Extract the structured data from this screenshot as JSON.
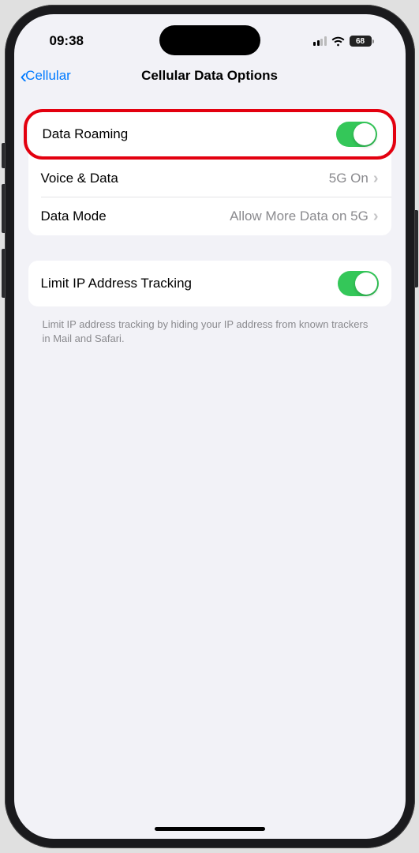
{
  "statusBar": {
    "time": "09:38",
    "batteryLevel": "68"
  },
  "navBar": {
    "backLabel": "Cellular",
    "title": "Cellular Data Options"
  },
  "group1": {
    "rows": [
      {
        "label": "Data Roaming"
      },
      {
        "label": "Voice & Data",
        "value": "5G On"
      },
      {
        "label": "Data Mode",
        "value": "Allow More Data on 5G"
      }
    ]
  },
  "group2": {
    "rows": [
      {
        "label": "Limit IP Address Tracking"
      }
    ],
    "footer": "Limit IP address tracking by hiding your IP address from known trackers in Mail and Safari."
  }
}
